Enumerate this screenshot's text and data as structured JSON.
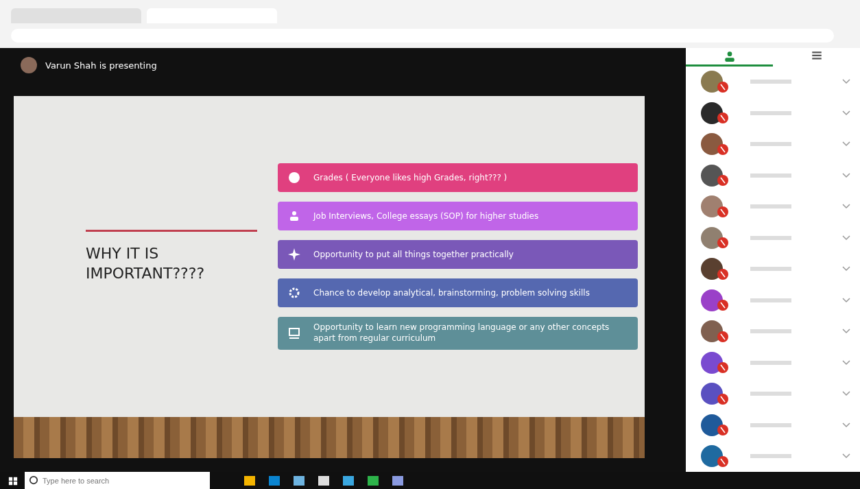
{
  "meeting": {
    "presenter_label": "Varun Shah is presenting"
  },
  "slide": {
    "title": "WHY IT IS IMPORTANT????",
    "points": [
      {
        "text": "Grades ( Everyone likes high Grades, right??? )",
        "color": "#e0407f",
        "kind": "grades"
      },
      {
        "text": "Job Interviews, College essays (SOP) for higher studies",
        "color": "#c065e8",
        "kind": "people"
      },
      {
        "text": "Opportunity to put all things together practically",
        "color": "#7a58b8",
        "kind": "spark"
      },
      {
        "text": "Chance to develop analytical, brainstorming, problem solving skills",
        "color": "#5568b0",
        "kind": "gear"
      },
      {
        "text": "Opportunity to learn new programming language or any other concepts apart from regular curriculum",
        "color": "#5e8f98",
        "kind": "board"
      }
    ]
  },
  "sidebar": {
    "tabs": [
      {
        "kind": "people",
        "selected": true
      },
      {
        "kind": "chat",
        "selected": false
      }
    ],
    "participants": [
      {
        "color": "#8a7a50"
      },
      {
        "color": "#2a2a2a"
      },
      {
        "color": "#8a5a40"
      },
      {
        "color": "#555555"
      },
      {
        "color": "#a08070"
      },
      {
        "color": "#908070"
      },
      {
        "color": "#5a4030"
      },
      {
        "color": "#9a40c8"
      },
      {
        "color": "#806050"
      },
      {
        "color": "#7a4ad0"
      },
      {
        "color": "#5a50c0"
      },
      {
        "color": "#1f5a9a"
      },
      {
        "color": "#1f6aa0"
      }
    ]
  },
  "taskbar": {
    "search_placeholder": "Type here to search"
  }
}
